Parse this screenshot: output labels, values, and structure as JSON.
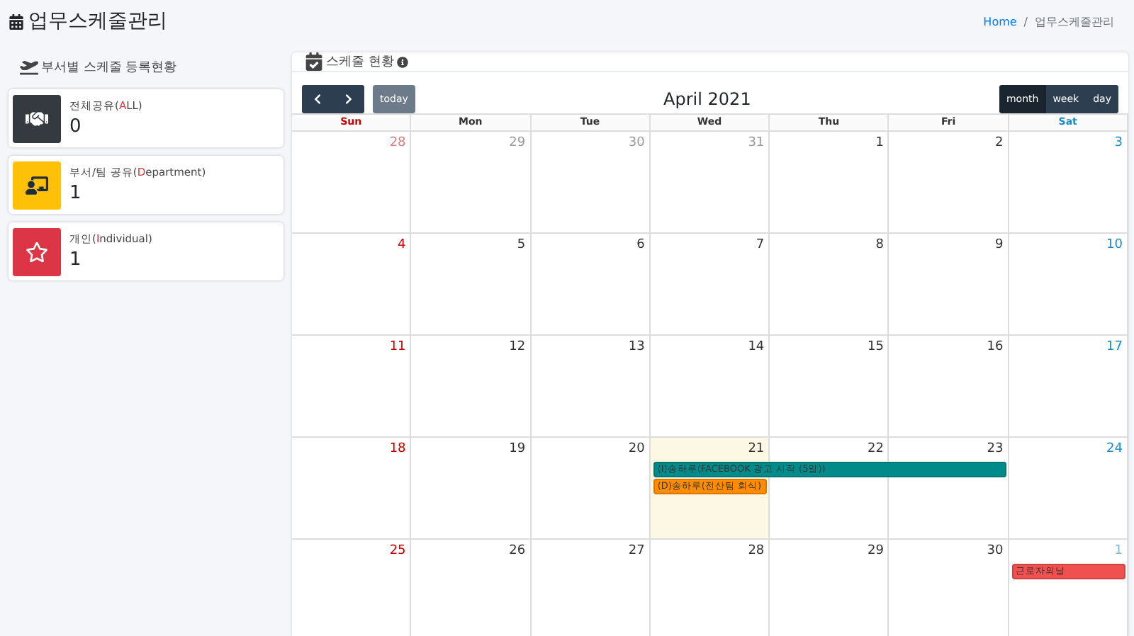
{
  "page_title": "업무스케줄관리",
  "breadcrumb": {
    "separator": "/",
    "items": [
      {
        "label": "Home",
        "kind": "link"
      },
      {
        "label": "업무스케줄관리",
        "kind": "current"
      }
    ]
  },
  "stats": {
    "title": "부서별 스케줄 등록현황",
    "items": [
      {
        "kind": "all",
        "label_before": "전체공유(",
        "label_mark": "A",
        "label_after": "LL)",
        "count": "0"
      },
      {
        "kind": "department",
        "label_before": "부서/팀 공유(",
        "label_mark": "D",
        "label_after": "epartment)",
        "count": "1"
      },
      {
        "kind": "individual",
        "label_before": "개인(",
        "label_mark": "I",
        "label_after": "ndividual)",
        "count": "1"
      }
    ]
  },
  "calendar": {
    "title": "스케줄 현황",
    "today_button": "today",
    "month_title": "April 2021",
    "views": [
      {
        "label": "month",
        "selected": true
      },
      {
        "label": "week",
        "selected": false
      },
      {
        "label": "day",
        "selected": false
      }
    ],
    "weekdays": [
      "Sun",
      "Mon",
      "Tue",
      "Wed",
      "Thu",
      "Fri",
      "Sat"
    ],
    "weeks": [
      {
        "days": [
          {
            "date": "28",
            "other_month": true,
            "today": false
          },
          {
            "date": "29",
            "other_month": true,
            "today": false
          },
          {
            "date": "30",
            "other_month": true,
            "today": false
          },
          {
            "date": "31",
            "other_month": true,
            "today": false
          },
          {
            "date": "1",
            "other_month": false,
            "today": false
          },
          {
            "date": "2",
            "other_month": false,
            "today": false
          },
          {
            "date": "3",
            "other_month": false,
            "today": false
          }
        ]
      },
      {
        "days": [
          {
            "date": "4",
            "other_month": false,
            "today": false
          },
          {
            "date": "5",
            "other_month": false,
            "today": false
          },
          {
            "date": "6",
            "other_month": false,
            "today": false
          },
          {
            "date": "7",
            "other_month": false,
            "today": false
          },
          {
            "date": "8",
            "other_month": false,
            "today": false
          },
          {
            "date": "9",
            "other_month": false,
            "today": false
          },
          {
            "date": "10",
            "other_month": false,
            "today": false
          }
        ]
      },
      {
        "days": [
          {
            "date": "11",
            "other_month": false,
            "today": false
          },
          {
            "date": "12",
            "other_month": false,
            "today": false
          },
          {
            "date": "13",
            "other_month": false,
            "today": false
          },
          {
            "date": "14",
            "other_month": false,
            "today": false
          },
          {
            "date": "15",
            "other_month": false,
            "today": false
          },
          {
            "date": "16",
            "other_month": false,
            "today": false
          },
          {
            "date": "17",
            "other_month": false,
            "today": false
          }
        ]
      },
      {
        "days": [
          {
            "date": "18",
            "other_month": false,
            "today": false
          },
          {
            "date": "19",
            "other_month": false,
            "today": false
          },
          {
            "date": "20",
            "other_month": false,
            "today": false
          },
          {
            "date": "21",
            "other_month": false,
            "today": true,
            "events": [
              {
                "kind": "start",
                "text": "(I)송하루(FACEBOOK 광고 시작 (5일))",
                "color": "#008b8b"
              },
              {
                "kind": "start",
                "text": "(D)송하루(전산팀 회식)",
                "color": "#ff8c00"
              }
            ]
          },
          {
            "date": "22",
            "other_month": false,
            "today": false,
            "events": [
              {
                "kind": "continuation"
              }
            ]
          },
          {
            "date": "23",
            "other_month": false,
            "today": false,
            "events": [
              {
                "kind": "continuation"
              }
            ]
          },
          {
            "date": "24",
            "other_month": false,
            "today": false
          }
        ]
      },
      {
        "days": [
          {
            "date": "25",
            "other_month": false,
            "today": false
          },
          {
            "date": "26",
            "other_month": false,
            "today": false
          },
          {
            "date": "27",
            "other_month": false,
            "today": false
          },
          {
            "date": "28",
            "other_month": false,
            "today": false
          },
          {
            "date": "29",
            "other_month": false,
            "today": false
          },
          {
            "date": "30",
            "other_month": false,
            "today": false
          },
          {
            "date": "1",
            "other_month": true,
            "today": false,
            "events": [
              {
                "kind": "start",
                "text": "근로자의날",
                "color": "#f05050"
              }
            ]
          }
        ]
      }
    ]
  }
}
